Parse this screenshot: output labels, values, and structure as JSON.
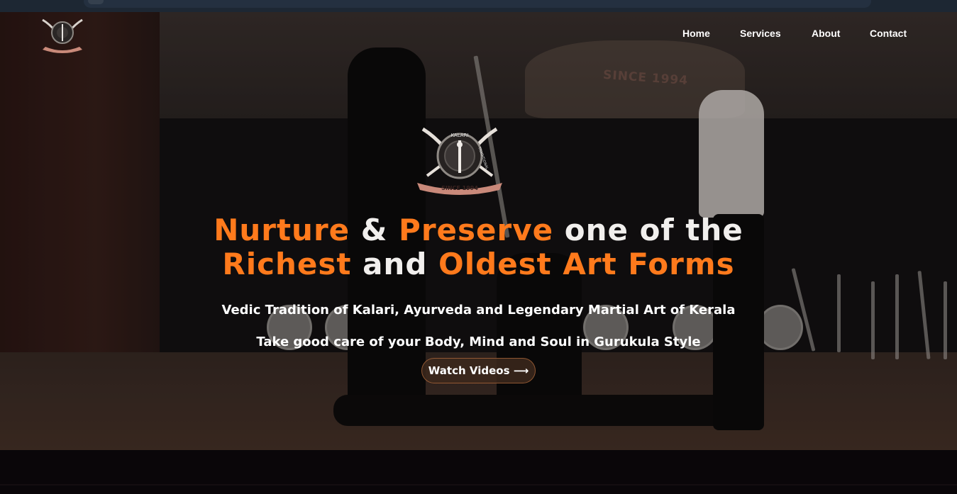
{
  "nav": {
    "home": "Home",
    "services": "Services",
    "about": "About",
    "contact": "Contact"
  },
  "logo": {
    "top_text": "KALARI",
    "side_text": "TRADITIONAL",
    "ribbon": "SINCE 1994"
  },
  "background": {
    "wall_text": "SINCE 1994"
  },
  "hero": {
    "line1": {
      "w1": "Nurture",
      "w2": "&",
      "w3": "Preserve",
      "w4": "one of the"
    },
    "line2": {
      "w1": "Richest",
      "w2": "and",
      "w3": "Oldest Art Forms"
    },
    "subtitle1": "Vedic Tradition of Kalari, Ayurveda and Legendary Martial Art of Kerala",
    "subtitle2": "Take good care of your Body, Mind and Soul in Gurukula Style",
    "cta": "Watch Videos ⟶"
  },
  "colors": {
    "accent": "#ff7a1c",
    "text": "#f1efed",
    "page_bottom": "#0a0609"
  }
}
